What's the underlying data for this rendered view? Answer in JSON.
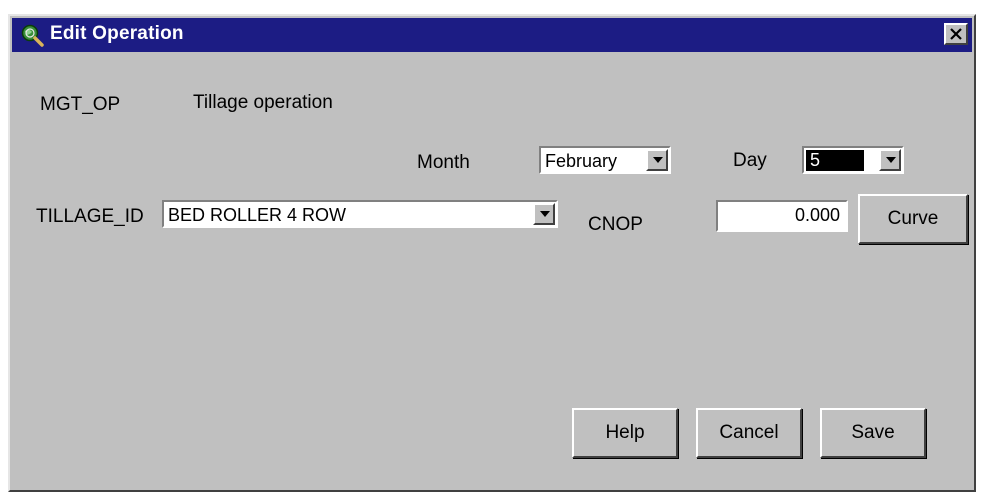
{
  "window": {
    "title": "Edit Operation"
  },
  "op": {
    "label": "MGT_OP",
    "value": "Tillage operation"
  },
  "date": {
    "month_label": "Month",
    "month_value": "February",
    "day_label": "Day",
    "day_value": "5"
  },
  "tillage": {
    "label": "TILLAGE_ID",
    "value": "BED ROLLER 4 ROW"
  },
  "cnop": {
    "label": "CNOP",
    "value": "0.000",
    "curve_button": "Curve"
  },
  "buttons": {
    "help": "Help",
    "cancel": "Cancel",
    "save": "Save"
  },
  "colors": {
    "titlebar": "#1c1c84",
    "dialog": "#c0c0c0"
  },
  "icons": {
    "title": "globe-magnifier-icon",
    "close": "close-icon",
    "dropdown": "dropdown-arrow-icon"
  }
}
